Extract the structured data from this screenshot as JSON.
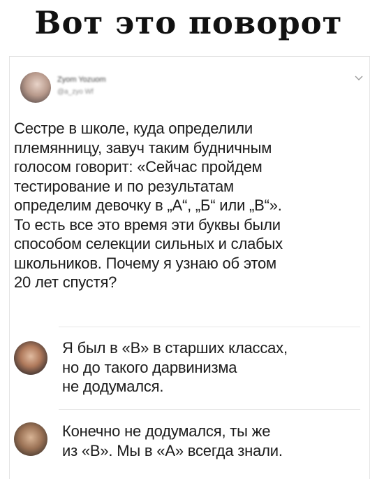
{
  "meme": {
    "title": "Вот это поворот"
  },
  "tweet": {
    "author_name": "Zyom Yozuom",
    "author_handle": "@a_zyo Wf",
    "text": "Сестре в школе, куда определили\nплемянницу, завуч таким будничным\nголосом говорит: «Сейчас пройдем\nтестирование и по результатам\nопределим девочку в „А“, „Б“ или „В“».\nТо есть все это время эти буквы были\nспособом селекции сильных и слабых\nшкольников. Почему я узнаю об этом\n20 лет спустя?"
  },
  "replies": [
    {
      "text": "Я был в «В» в старших классах,\nно до такого дарвинизма\nне додумался."
    },
    {
      "text": "Конечно не додумался, ты же\nиз «В». Мы в «А» всегда знали."
    }
  ],
  "icons": {
    "menu": "chevron-down-icon"
  }
}
